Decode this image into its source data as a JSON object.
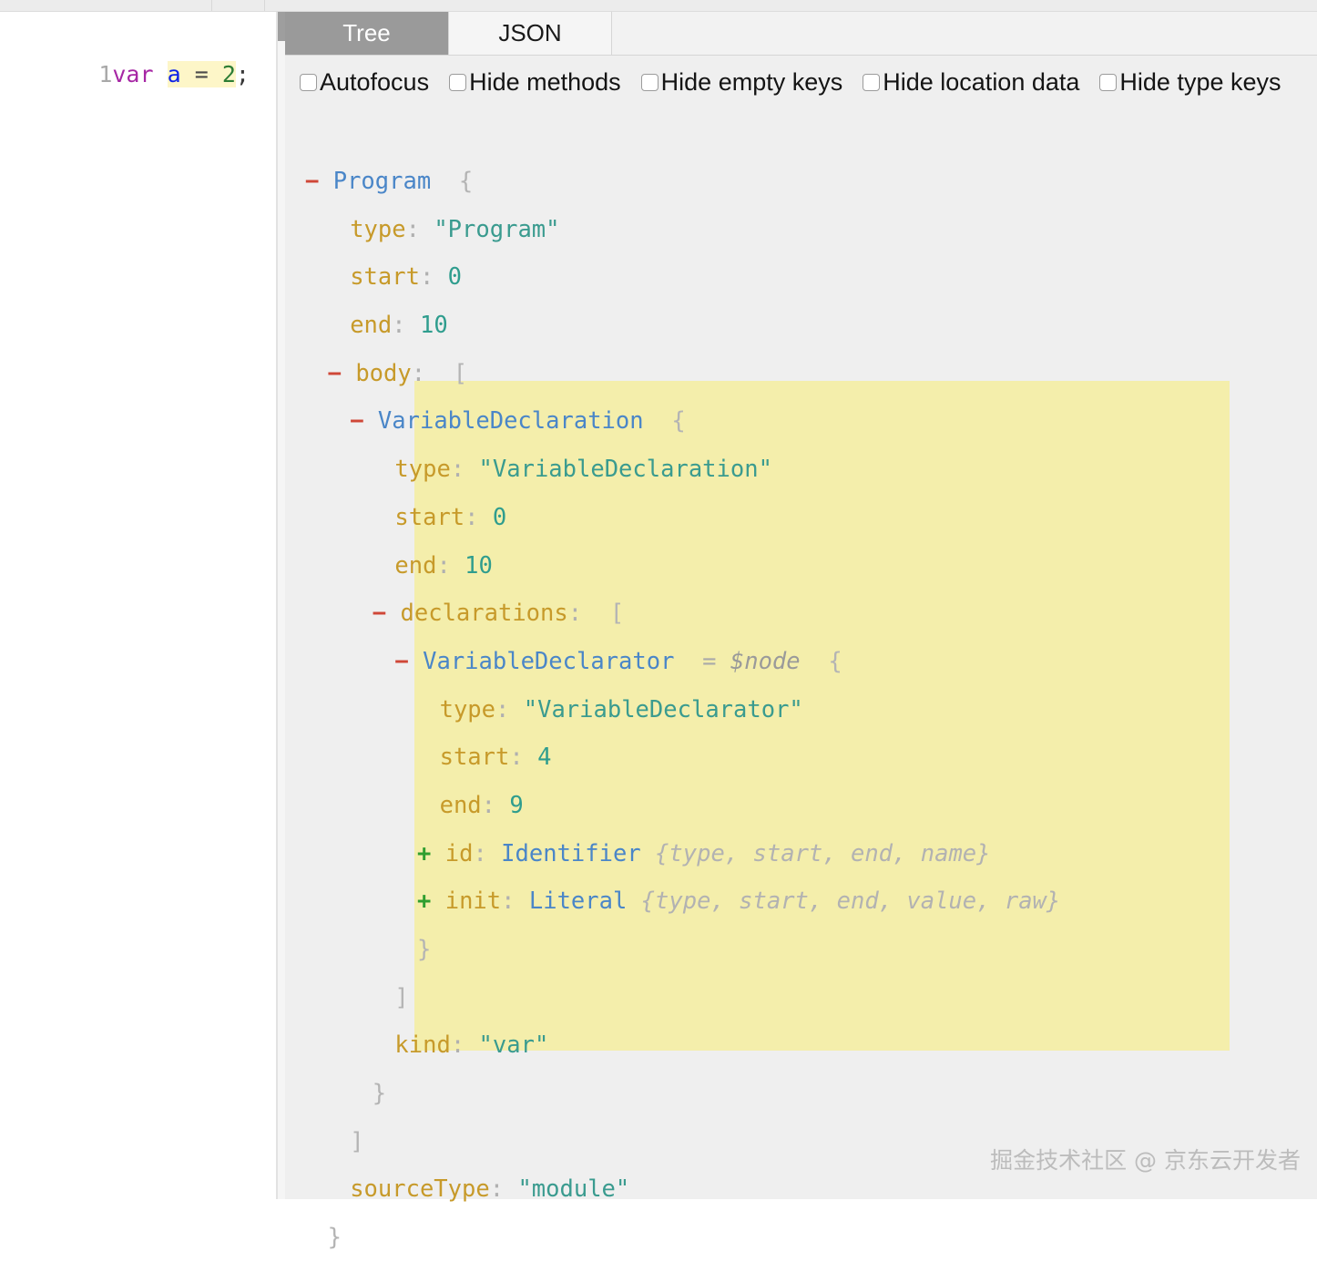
{
  "editor": {
    "line_number": "1",
    "tokens": [
      {
        "t": "var",
        "k": "kw"
      },
      {
        "t": " ",
        "k": "plain"
      },
      {
        "t": "a",
        "k": "ident-sel"
      },
      {
        "t": " ",
        "k": "sel"
      },
      {
        "t": "=",
        "k": "op-sel"
      },
      {
        "t": " ",
        "k": "sel"
      },
      {
        "t": "2",
        "k": "num-sel"
      },
      {
        "t": ";",
        "k": "punc"
      }
    ],
    "source_text": "var a = 2;"
  },
  "tabs": [
    {
      "label": "Tree",
      "active": true
    },
    {
      "label": "JSON",
      "active": false
    }
  ],
  "options": [
    {
      "label": "Autofocus",
      "checked": false
    },
    {
      "label": "Hide methods",
      "checked": false
    },
    {
      "label": "Hide empty keys",
      "checked": false
    },
    {
      "label": "Hide location data",
      "checked": false
    },
    {
      "label": "Hide type keys",
      "checked": false
    }
  ],
  "tree_rows": [
    {
      "indent": 0,
      "toggle": "-",
      "node": "Program",
      "open": "{"
    },
    {
      "indent": 2,
      "key": "type",
      "value": "\"Program\"",
      "vtype": "str"
    },
    {
      "indent": 2,
      "key": "start",
      "value": "0",
      "vtype": "num"
    },
    {
      "indent": 2,
      "key": "end",
      "value": "10",
      "vtype": "num"
    },
    {
      "indent": 1,
      "toggle": "-",
      "key": "body",
      "open": "["
    },
    {
      "indent": 2,
      "toggle": "-",
      "node": "VariableDeclaration",
      "open": "{"
    },
    {
      "indent": 4,
      "key": "type",
      "value": "\"VariableDeclaration\"",
      "vtype": "str"
    },
    {
      "indent": 4,
      "key": "start",
      "value": "0",
      "vtype": "num"
    },
    {
      "indent": 4,
      "key": "end",
      "value": "10",
      "vtype": "num"
    },
    {
      "indent": 3,
      "toggle": "-",
      "key": "declarations",
      "open": "["
    },
    {
      "indent": 4,
      "toggle": "-",
      "node": "VariableDeclarator",
      "assign": "=",
      "varname": "$node",
      "open": "{"
    },
    {
      "indent": 6,
      "key": "type",
      "value": "\"VariableDeclarator\"",
      "vtype": "str"
    },
    {
      "indent": 6,
      "key": "start",
      "value": "4",
      "vtype": "num"
    },
    {
      "indent": 6,
      "key": "end",
      "value": "9",
      "vtype": "num"
    },
    {
      "indent": 5,
      "toggle": "+",
      "key": "id",
      "node": "Identifier",
      "preview": "{type, start, end, name}"
    },
    {
      "indent": 5,
      "toggle": "+",
      "key": "init",
      "node": "Literal",
      "preview": "{type, start, end, value, raw}"
    },
    {
      "indent": 5,
      "close": "}"
    },
    {
      "indent": 4,
      "close": "]"
    },
    {
      "indent": 4,
      "key": "kind",
      "value": "\"var\"",
      "vtype": "str"
    },
    {
      "indent": 3,
      "close": "}"
    },
    {
      "indent": 2,
      "close": "]"
    },
    {
      "indent": 2,
      "key": "sourceType",
      "value": "\"module\"",
      "vtype": "str"
    },
    {
      "indent": 1,
      "close": "}"
    }
  ],
  "watermark": "掘金技术社区 @ 京东云开发者",
  "colors": {
    "highlight": "#f4eeab",
    "panel_bg": "#efefef",
    "active_tab_bg": "#9a9a9a",
    "node_name": "#4a86c8",
    "key": "#c79a2a",
    "string_value": "#3a9b8f",
    "collapse_minus": "#cf4737",
    "expand_plus": "#2f9e2f",
    "preview": "#b2b2b2",
    "editor_selection": "#fdf6c8"
  }
}
